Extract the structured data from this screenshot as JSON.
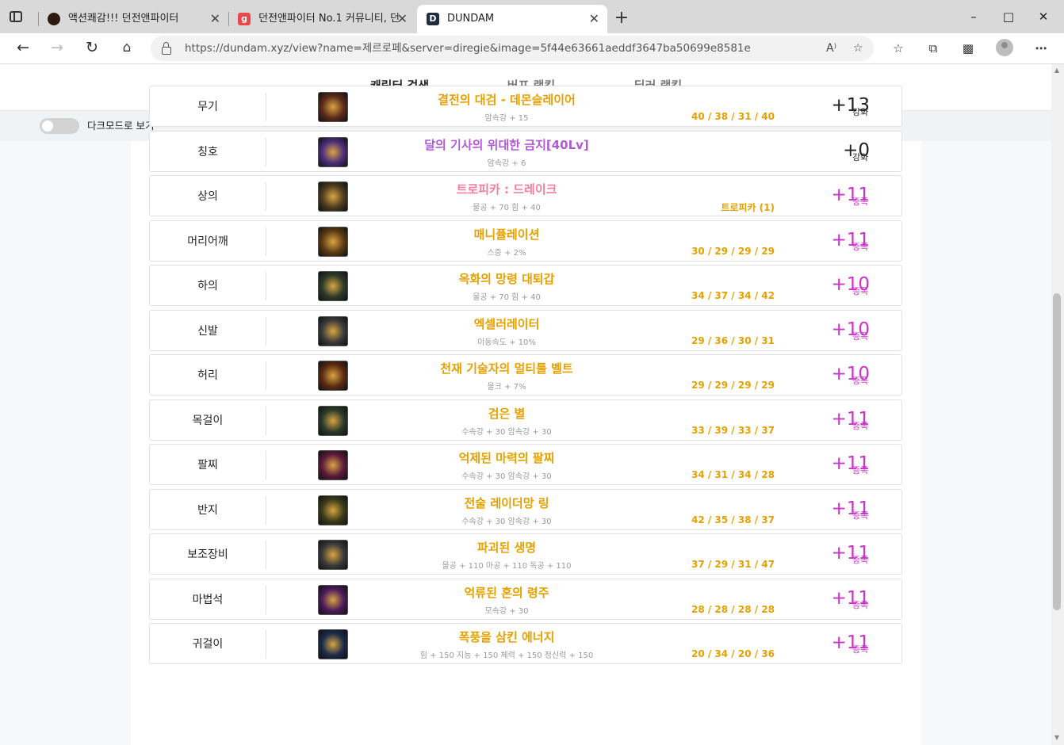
{
  "browser": {
    "tabs": [
      {
        "title": "액션쾌감!!! 던전앤파이터",
        "active": false
      },
      {
        "title": "던전앤파이터 No.1 커뮤니티, 던",
        "active": false
      },
      {
        "title": "DUNDAM",
        "active": true
      }
    ],
    "url": "https://dundam.xyz/view?name=제르로페&server=diregie&image=5f44e63661aeddf3647ba50699e8581e",
    "new_tab_glyph": "+",
    "close_glyph": "✕"
  },
  "page": {
    "tabs": [
      "캐릭터 검색",
      "버프 랭킹",
      "딜러 랭킹"
    ],
    "active_tab": 0,
    "dark_mode_label": "다크모드로 보기",
    "dark_mode_on": false
  },
  "equipment": [
    {
      "slot": "무기",
      "name": "결전의 대검 - 데몬슬레이어",
      "option": "암속강 + 15",
      "stats": "40 / 38 / 31 / 40",
      "plus": "+13",
      "type": "강화",
      "name_color": "epic",
      "icon_color": "#5a2a1a"
    },
    {
      "slot": "칭호",
      "name": "달의 기사의 위대한 금지[40Lv]",
      "option": "암속강 + 6",
      "stats": "",
      "plus": "+0",
      "type": "강화",
      "name_color": "rare",
      "icon_color": "#4b2c7a"
    },
    {
      "slot": "상의",
      "name": "트로피카 : 드레이크",
      "option": "물공 + 70 힘 + 40",
      "stats": "트로피카 (1)",
      "plus": "+11",
      "type": "증폭",
      "name_color": "pink",
      "icon_color": "#4a3a1f"
    },
    {
      "slot": "머리어깨",
      "name": "매니퓰레이션",
      "option": "스증 + 2%",
      "stats": "30 / 29 / 29 / 29",
      "plus": "+11",
      "type": "증폭",
      "name_color": "epic",
      "icon_color": "#5a3a12"
    },
    {
      "slot": "하의",
      "name": "옥화의 망령 대퇴갑",
      "option": "물공 + 70 힘 + 40",
      "stats": "34 / 37 / 34 / 42",
      "plus": "+10",
      "type": "증폭",
      "name_color": "epic",
      "icon_color": "#2c3a2a"
    },
    {
      "slot": "신발",
      "name": "엑셀러레이터",
      "option": "이동속도 + 10%",
      "stats": "29 / 36 / 30 / 31",
      "plus": "+10",
      "type": "증폭",
      "name_color": "epic",
      "icon_color": "#3a3a3a"
    },
    {
      "slot": "허리",
      "name": "천재 기술자의 멀티툴 벨트",
      "option": "물크 + 7%",
      "stats": "29 / 29 / 29 / 29",
      "plus": "+10",
      "type": "증폭",
      "name_color": "epic",
      "icon_color": "#5a2a12"
    },
    {
      "slot": "목걸이",
      "name": "검은 별",
      "option": "수속강 + 30 암속강 + 30",
      "stats": "33 / 39 / 33 / 37",
      "plus": "+11",
      "type": "증폭",
      "name_color": "epic",
      "icon_color": "#2a3a2a"
    },
    {
      "slot": "팔찌",
      "name": "억제된 마력의 팔찌",
      "option": "수속강 + 30 암속강 + 30",
      "stats": "34 / 31 / 34 / 28",
      "plus": "+11",
      "type": "증폭",
      "name_color": "epic",
      "icon_color": "#5a1a3a"
    },
    {
      "slot": "반지",
      "name": "전술 레이더망 링",
      "option": "수속강 + 30 암속강 + 30",
      "stats": "42 / 35 / 38 / 37",
      "plus": "+11",
      "type": "증폭",
      "name_color": "epic",
      "icon_color": "#3a3a1a"
    },
    {
      "slot": "보조장비",
      "name": "파괴된 생명",
      "option": "물공 + 110 마공 + 110 독공 + 110",
      "stats": "37 / 29 / 31 / 47",
      "plus": "+11",
      "type": "증폭",
      "name_color": "epic",
      "icon_color": "#3a3a3a"
    },
    {
      "slot": "마법석",
      "name": "억류된 혼의 령주",
      "option": "모속강 + 30",
      "stats": "28 / 28 / 28 / 28",
      "plus": "+11",
      "type": "증폭",
      "name_color": "epic",
      "icon_color": "#4a1a5a"
    },
    {
      "slot": "귀걸이",
      "name": "폭풍을 삼킨 에너지",
      "option": "힘 + 150 지능 + 150 체력 + 150 정신력 + 150",
      "stats": "20 / 34 / 20 / 36",
      "plus": "+11",
      "type": "증폭",
      "name_color": "epic",
      "icon_color": "#1a2a4a"
    }
  ],
  "colors": {
    "epic": "#e6a100",
    "rare": "#b05ad6",
    "pink": "#f07fa0",
    "amplify": "#cc33cc",
    "active_tab_underline": "#5d7ea3"
  }
}
